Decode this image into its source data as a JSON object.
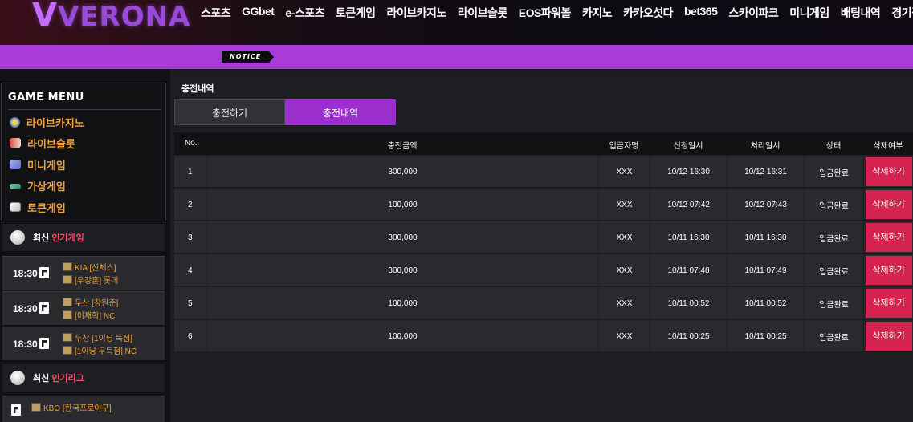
{
  "header": {
    "logo_text": "VERONA",
    "nav": [
      "스포츠",
      "GGbet",
      "e-스포츠",
      "토큰게임",
      "라이브카지노",
      "라이브슬롯",
      "EOS파워볼",
      "카지노",
      "카카오섯다",
      "bet365",
      "스카이파크",
      "미니게임",
      "배팅내역",
      "경기결과"
    ]
  },
  "notice": {
    "badge": "NOTICE"
  },
  "sidebar": {
    "game_menu_title": "GAME MENU",
    "game_menu": [
      {
        "label": "라이브카지노",
        "icon": "casino-chip-icon"
      },
      {
        "label": "라이브슬롯",
        "icon": "slot-machine-icon"
      },
      {
        "label": "미니게임",
        "icon": "dice-icon"
      },
      {
        "label": "가상게임",
        "icon": "virtual-game-icon"
      },
      {
        "label": "토큰게임",
        "icon": "token-game-icon"
      }
    ],
    "popular_games": {
      "title_prefix": "최신",
      "title_highlight": "인기게임",
      "matches": [
        {
          "time": "18:30",
          "team1": "KIA [산체스]",
          "team2": "[우강훈] 롯데"
        },
        {
          "time": "18:30",
          "team1": "두산 [창원준]",
          "team2": "[이재학] NC"
        },
        {
          "time": "18:30",
          "team1": "두산 [1이닝 득점]",
          "team2": "[1이닝 무득점] NC"
        }
      ]
    },
    "popular_leagues": {
      "title_prefix": "최신",
      "title_highlight": "인기리그",
      "items": [
        {
          "name": "KBO [한국프로야구]"
        }
      ]
    }
  },
  "main": {
    "page_title": "충전내역",
    "tabs": [
      {
        "label": "충전하기"
      },
      {
        "label": "충전내역"
      }
    ],
    "active_tab": "충전내역",
    "columns": [
      "No.",
      "충전금액",
      "입금자명",
      "신청일시",
      "처리일시",
      "상태",
      "삭제여부"
    ],
    "rows": [
      {
        "no": "1",
        "amount": "300,000",
        "depositor": "XXX",
        "requested": "10/12 16:30",
        "processed": "10/12 16:31",
        "status": "입금완료",
        "delete": "삭제하기"
      },
      {
        "no": "2",
        "amount": "100,000",
        "depositor": "XXX",
        "requested": "10/12 07:42",
        "processed": "10/12 07:43",
        "status": "입금완료",
        "delete": "삭제하기"
      },
      {
        "no": "3",
        "amount": "300,000",
        "depositor": "XXX",
        "requested": "10/11 16:30",
        "processed": "10/11 16:30",
        "status": "입금완료",
        "delete": "삭제하기"
      },
      {
        "no": "4",
        "amount": "300,000",
        "depositor": "XXX",
        "requested": "10/11 07:48",
        "processed": "10/11 07:49",
        "status": "입금완료",
        "delete": "삭제하기"
      },
      {
        "no": "5",
        "amount": "100,000",
        "depositor": "XXX",
        "requested": "10/11 00:52",
        "processed": "10/11 00:52",
        "status": "입금완료",
        "delete": "삭제하기"
      },
      {
        "no": "6",
        "amount": "100,000",
        "depositor": "XXX",
        "requested": "10/11 00:25",
        "processed": "10/11 00:25",
        "status": "입금완료",
        "delete": "삭제하기"
      }
    ]
  },
  "colors": {
    "accent": "#9a2fce",
    "notice_bar": "#a93bd8",
    "delete_button": "#d4234e",
    "menu_text": "#f0a03c",
    "highlight_text": "#ff4b6e"
  }
}
